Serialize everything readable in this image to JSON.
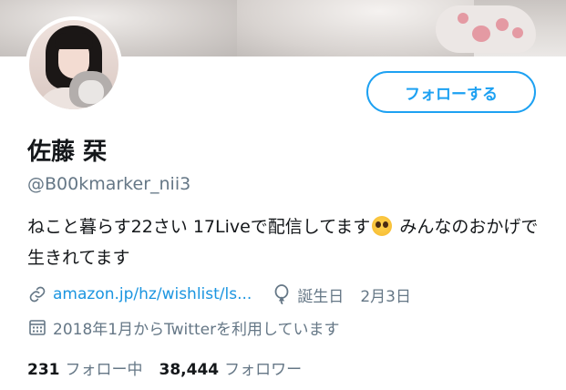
{
  "profile": {
    "name": "佐藤 栞",
    "handle": "@B00kmarker_nii3",
    "bio_part1": "ねこと暮らす22さい 17Liveで配信してます",
    "bio_emoji": "pleading-face-emoji",
    "bio_part2": " みんなのおかげで生きれてます",
    "link": "amazon.jp/hz/wishlist/ls...",
    "birthday_label": "誕生日",
    "birthday_date": "2月3日",
    "joined": "2018年1月からTwitterを利用しています"
  },
  "follow_button": {
    "label": "フォローする"
  },
  "stats": {
    "following_count": "231",
    "following_label": "フォロー中",
    "followers_count": "38,444",
    "followers_label": "フォロワー"
  },
  "colors": {
    "accent": "#1da1f2",
    "link": "#1b95e0",
    "secondary_text": "#657786",
    "primary_text": "#14171a"
  },
  "icons": {
    "link": "link-icon",
    "birthday": "balloon-icon",
    "joined": "calendar-icon"
  }
}
